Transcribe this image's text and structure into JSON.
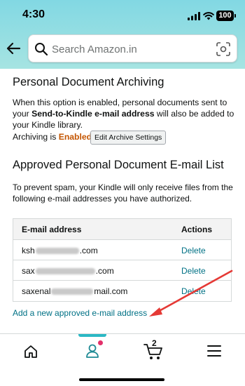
{
  "status_bar": {
    "time": "4:30",
    "battery": "100"
  },
  "search": {
    "placeholder": "Search Amazon.in"
  },
  "archiving": {
    "heading": "Personal Document Archiving",
    "desc_pre": "When this option is enabled, personal documents sent to your ",
    "desc_bold": "Send-to-Kindle e-mail address",
    "desc_post": " will also be added to your Kindle library.",
    "status_label": "Archiving is ",
    "status_value": "Enabled",
    "edit_button": "Edit Archive Settings"
  },
  "approved": {
    "heading": "Approved Personal Document E-mail List",
    "desc": "To prevent spam, your Kindle will only receive files from the following e-mail addresses you have authorized.",
    "col_email": "E-mail address",
    "col_actions": "Actions",
    "rows": [
      {
        "prefix": "ksh",
        "suffix": ".com",
        "action": "Delete"
      },
      {
        "prefix": "sax",
        "suffix": ".com",
        "action": "Delete"
      },
      {
        "prefix": "saxenal",
        "suffix": "mail.com",
        "action": "Delete"
      }
    ],
    "add_link": "Add a new approved e-mail address"
  },
  "bottom_nav": {
    "cart_count": "2"
  },
  "colors": {
    "accent_teal": "#2bb8c4",
    "link": "#007185",
    "enabled": "#c45500",
    "annotation_arrow": "#e53935"
  }
}
